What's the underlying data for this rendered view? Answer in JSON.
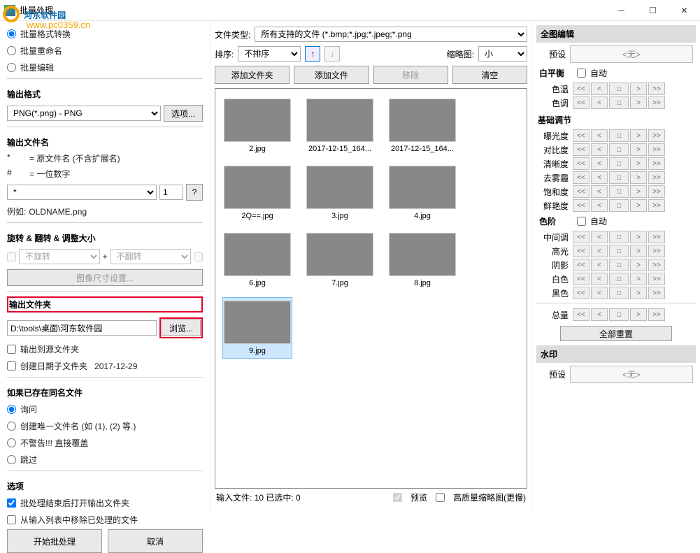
{
  "window": {
    "title": "批量处理"
  },
  "watermark": {
    "brand": "河东软件园",
    "url": "www.pc0359.cn"
  },
  "left": {
    "mode": {
      "convert": "批量格式转换",
      "rename": "批量重命名",
      "edit": "批量编辑",
      "selected": "convert"
    },
    "output_format": {
      "label": "输出格式",
      "value": "PNG(*.png) - PNG",
      "options_btn": "选项..."
    },
    "output_name": {
      "label": "输出文件名",
      "legend_star": "*",
      "legend_star_txt": "= 原文件名 (不含扩展名)",
      "legend_hash": "#",
      "legend_hash_txt": "= 一位数字",
      "pattern": "*",
      "start_num": "1",
      "help": "?",
      "example_label": "例如:",
      "example_value": "OLDNAME.png"
    },
    "rotate": {
      "label": "旋转 & 翻转 & 调整大小",
      "rotate_val": "不旋转",
      "flip_val": "不翻转",
      "plus": "+",
      "resize_btn": "图像尺寸设置..."
    },
    "output_folder": {
      "label": "输出文件夹",
      "path": "D:\\tools\\桌面\\河东软件园",
      "browse": "浏览...",
      "to_source": "输出到源文件夹",
      "date_sub": "创建日期子文件夹",
      "date_val": "2017-12-29"
    },
    "conflict": {
      "label": "如果已存在同名文件",
      "ask": "询问",
      "unique": "创建唯一文件名 (如 (1), (2) 等.)",
      "overwrite": "不警告!!! 直接覆盖",
      "skip": "跳过",
      "selected": "ask"
    },
    "options": {
      "label": "选项",
      "open_after": "批处理结束后打开输出文件夹",
      "remove_done": "从输入列表中移除已处理的文件"
    },
    "actions": {
      "start": "开始批处理",
      "cancel": "取消"
    }
  },
  "center": {
    "file_type_label": "文件类型:",
    "file_type_value": "所有支持的文件 (*.bmp;*.jpg;*.jpeg;*.png",
    "sort_label": "排序:",
    "sort_value": "不排序",
    "thumb_label": "缩略图:",
    "thumb_value": "小",
    "btn_add_folder": "添加文件夹",
    "btn_add_file": "添加文件",
    "btn_remove": "移除",
    "btn_clear": "清空",
    "thumbs": [
      {
        "name": "2.jpg",
        "cls": "g1"
      },
      {
        "name": "2017-12-15_164...",
        "cls": "g2"
      },
      {
        "name": "2017-12-15_164...",
        "cls": "g3"
      },
      {
        "name": "2Q==.jpg",
        "cls": "g4"
      },
      {
        "name": "3.jpg",
        "cls": "g5"
      },
      {
        "name": "4.jpg",
        "cls": "g6"
      },
      {
        "name": "6.jpg",
        "cls": "g7"
      },
      {
        "name": "7.jpg",
        "cls": "g8"
      },
      {
        "name": "8.jpg",
        "cls": "g9"
      },
      {
        "name": "9.jpg",
        "cls": "g10",
        "selected": true
      }
    ],
    "status_left": "输入文件: 10 已选中: 0",
    "preview": "预览",
    "hq_thumb": "高质量缩略图(更慢)"
  },
  "right": {
    "title": "全图编辑",
    "preset_label": "预设",
    "preset_none": "<无>",
    "wb": {
      "label": "白平衡",
      "auto": "自动",
      "temp": "色温",
      "tint": "色调"
    },
    "basic": {
      "label": "基础调节",
      "exposure": "曝光度",
      "contrast": "对比度",
      "clarity": "清晰度",
      "dehaze": "去雾霾",
      "sat": "饱和度",
      "vib": "鲜艳度"
    },
    "levels": {
      "label": "色阶",
      "auto": "自动",
      "mid": "中间调",
      "hi": "高光",
      "sh": "阴影",
      "white": "白色",
      "black": "黑色"
    },
    "total": "总量",
    "reset_all": "全部重置",
    "watermark_label": "水印"
  }
}
